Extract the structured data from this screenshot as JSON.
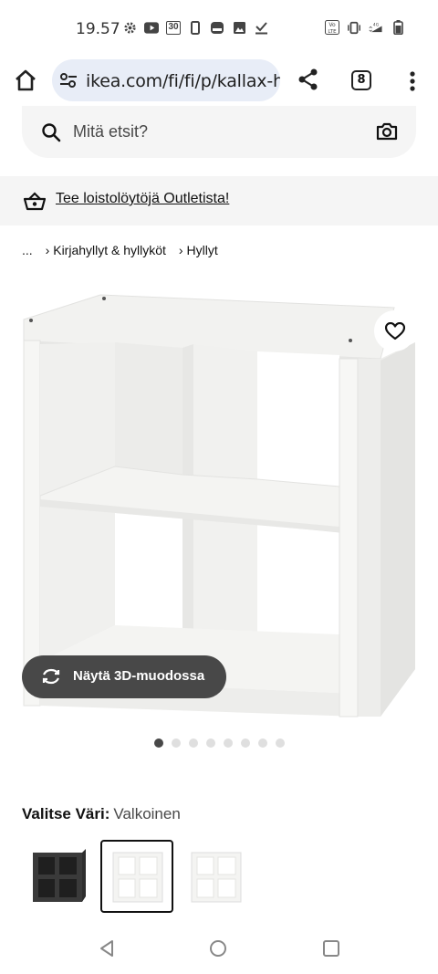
{
  "status_bar": {
    "time": "19.57",
    "icons": [
      "settings-icon",
      "youtube-icon",
      "calendar-icon",
      "phone-icon",
      "app-icon",
      "gallery-icon",
      "check-icon"
    ],
    "calendar_day": "30",
    "right_icons": [
      "volte-icon",
      "vibrate-icon",
      "network-4g-icon",
      "battery-icon"
    ]
  },
  "browser": {
    "url": "ikea.com/fi/fi/p/kallax-hyllykko",
    "tab_count": "8"
  },
  "search": {
    "placeholder": "Mitä etsit?"
  },
  "banner": {
    "link_text": "Tee loistolöytöjä Outletista!"
  },
  "breadcrumb": {
    "ellipsis": "...",
    "items": [
      "Kirjahyllyt & hyllyköt",
      "Hyllyt"
    ]
  },
  "product": {
    "view_3d_label": "Näytä 3D-muodossa",
    "image_count": 8,
    "active_image": 0
  },
  "color_picker": {
    "label": "Valitse Väri:",
    "selected": "Valkoinen",
    "swatches": [
      {
        "name": "black-brown",
        "color": "#3a3a3a"
      },
      {
        "name": "white",
        "color": "#f4f4f2",
        "selected": true
      },
      {
        "name": "white-alt",
        "color": "#f4f4f2"
      }
    ]
  }
}
